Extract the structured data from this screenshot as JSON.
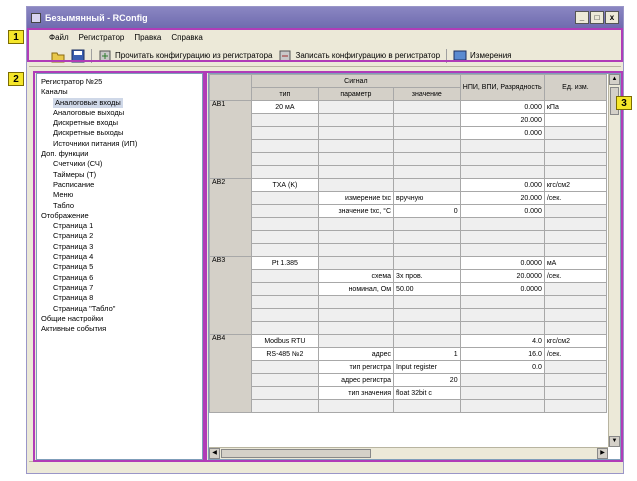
{
  "window": {
    "title": "Безымянный - RConfig",
    "minimize": "_",
    "maximize": "□",
    "close": "x"
  },
  "menu": [
    "Файл",
    "Регистратор",
    "Правка",
    "Справка"
  ],
  "toolbar": {
    "read_config": "Прочитать конфигурацию из регистратора",
    "write_config": "Записать конфигурацию в регистратор",
    "measure": "Измерения"
  },
  "markers": [
    "1",
    "2",
    "3"
  ],
  "tree": {
    "root": "Регистратор №25",
    "groups": [
      {
        "label": "Каналы",
        "items": [
          "Аналоговые входы",
          "Аналоговые выходы",
          "Дискретные входы",
          "Дискретные выходы",
          "Источники питания (ИП)"
        ]
      },
      {
        "label": "Доп. функции",
        "items": [
          "Счетчики (СЧ)",
          "Таймеры (Т)",
          "Расписание",
          "Меню",
          "Табло"
        ]
      },
      {
        "label": "Отображение",
        "items": [
          "Страница 1",
          "Страница 2",
          "Страница 3",
          "Страница 4",
          "Страница 5",
          "Страница 6",
          "Страница 7",
          "Страница 8",
          "Страница \"Табло\""
        ]
      }
    ],
    "tail": [
      "Общие настройки",
      "Активные события"
    ],
    "selected": "Аналоговые входы"
  },
  "grid": {
    "header": {
      "signal": "Сигнал",
      "type": "тип",
      "param": "параметр",
      "value": "значение",
      "npi": "НПИ, ВПИ, Разрядность",
      "units": "Ед. изм."
    },
    "rows": [
      {
        "id": "АВ1",
        "type": "20 мА",
        "type2": "",
        "params": [],
        "npi": [
          "0.000",
          "20.000",
          "0.000"
        ],
        "units": [
          "кПа",
          ""
        ]
      },
      {
        "id": "АВ2",
        "type": "ТХА (K)",
        "type2": "",
        "params": [
          {
            "name": "измерение tхс",
            "value": "вручную",
            "extra": ""
          },
          {
            "name": "значение tхс, °С",
            "value": "",
            "extra": "0"
          }
        ],
        "npi": [
          "0.000",
          "20.000",
          "0.000"
        ],
        "units": [
          "кгс/см2",
          "/сек."
        ]
      },
      {
        "id": "АВ3",
        "type": "Pt 1.385",
        "type2": "",
        "params": [
          {
            "name": "схема",
            "value": "3х пров.",
            "extra": ""
          },
          {
            "name": "номинал, Ом",
            "value": "50.00",
            "extra": ""
          }
        ],
        "npi": [
          "0.0000",
          "20.0000",
          "0.0000"
        ],
        "units": [
          "мА",
          "/сек."
        ]
      },
      {
        "id": "АВ4",
        "type": "Modbus RTU",
        "type2": "RS-485 №2",
        "params": [
          {
            "name": "адрес",
            "value": "",
            "extra": "1"
          },
          {
            "name": "тип регистра",
            "value": "Input register",
            "extra": ""
          },
          {
            "name": "адрес регистра",
            "value": "",
            "extra": "20"
          },
          {
            "name": "тип значения",
            "value": "float 32bit c",
            "extra": ""
          }
        ],
        "npi": [
          "4.0",
          "16.0",
          "0.0"
        ],
        "units": [
          "кгс/см2",
          "/сек."
        ]
      }
    ]
  },
  "colors": {
    "highlight": "#b03cb8",
    "marker": "#f5e62a",
    "titlebar": "#7b77b8"
  }
}
